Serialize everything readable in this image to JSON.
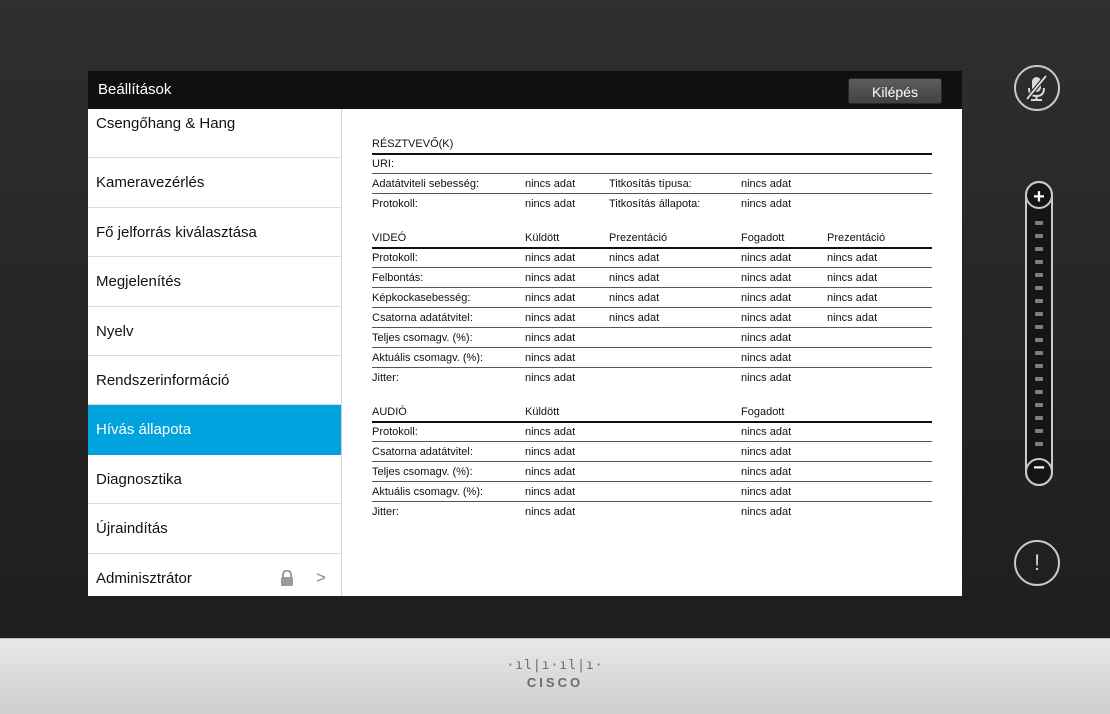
{
  "window": {
    "title": "Beállítások",
    "exit_label": "Kilépés"
  },
  "sidebar": {
    "active_index": 6,
    "items": [
      {
        "label": "Csengőhang & Hang"
      },
      {
        "label": "Kameravezérlés"
      },
      {
        "label": "Fő jelforrás kiválasztása"
      },
      {
        "label": "Megjelenítés"
      },
      {
        "label": "Nyelv"
      },
      {
        "label": "Rendszerinformáció"
      },
      {
        "label": "Hívás állapota"
      },
      {
        "label": "Diagnosztika"
      },
      {
        "label": "Újraindítás"
      },
      {
        "label": "Adminisztrátor",
        "icons": [
          "lock-icon",
          "chevron-right-icon"
        ]
      }
    ]
  },
  "participant": {
    "header": "RÉSZTVEVŐ(K)",
    "rows": [
      [
        "URI:",
        "",
        "",
        ""
      ],
      [
        "Adatátviteli sebesség:",
        "nincs adat",
        "Titkosítás típusa:",
        "nincs adat"
      ],
      [
        "Protokoll:",
        "nincs adat",
        "Titkosítás állapota:",
        "nincs adat"
      ]
    ]
  },
  "video": {
    "headers": [
      "VIDEÓ",
      "Küldött",
      "Prezentáció",
      "Fogadott",
      "Prezentáció"
    ],
    "rows": [
      [
        "Protokoll:",
        "nincs adat",
        "nincs adat",
        "nincs adat",
        "nincs adat"
      ],
      [
        "Felbontás:",
        "nincs adat",
        "nincs adat",
        "nincs adat",
        "nincs adat"
      ],
      [
        "Képkockasebesség:",
        "nincs adat",
        "nincs adat",
        "nincs adat",
        "nincs adat"
      ],
      [
        "Csatorna adatátvitel:",
        "nincs adat",
        "nincs adat",
        "nincs adat",
        "nincs adat"
      ],
      [
        "Teljes csomagv. (%):",
        "nincs adat",
        "",
        "nincs adat",
        ""
      ],
      [
        "Aktuális csomagv. (%):",
        "nincs adat",
        "",
        "nincs adat",
        ""
      ],
      [
        "Jitter:",
        "nincs adat",
        "",
        "nincs adat",
        ""
      ]
    ]
  },
  "audio": {
    "headers": [
      "AUDIÓ",
      "Küldött",
      "",
      "Fogadott",
      ""
    ],
    "rows": [
      [
        "Protokoll:",
        "nincs adat",
        "",
        "nincs adat",
        ""
      ],
      [
        "Csatorna adatátvitel:",
        "nincs adat",
        "",
        "nincs adat",
        ""
      ],
      [
        "Teljes csomagv. (%):",
        "nincs adat",
        "",
        "nincs adat",
        ""
      ],
      [
        "Aktuális csomagv. (%):",
        "nincs adat",
        "",
        "nincs adat",
        ""
      ],
      [
        "Jitter:",
        "nincs adat",
        "",
        "nincs adat",
        ""
      ]
    ]
  },
  "controls": {
    "volume_plus": "+",
    "volume_minus": "−",
    "alert_symbol": "!",
    "icons": [
      "microphone-muted-icon",
      "alert-icon"
    ]
  },
  "footer": {
    "logo_bars": "·ıl|ı·ıl|ı·",
    "logo_word": "CISCO"
  },
  "colors": {
    "accent": "#00a3de",
    "titlebar": "#101010",
    "background": "#2a2a2a"
  }
}
